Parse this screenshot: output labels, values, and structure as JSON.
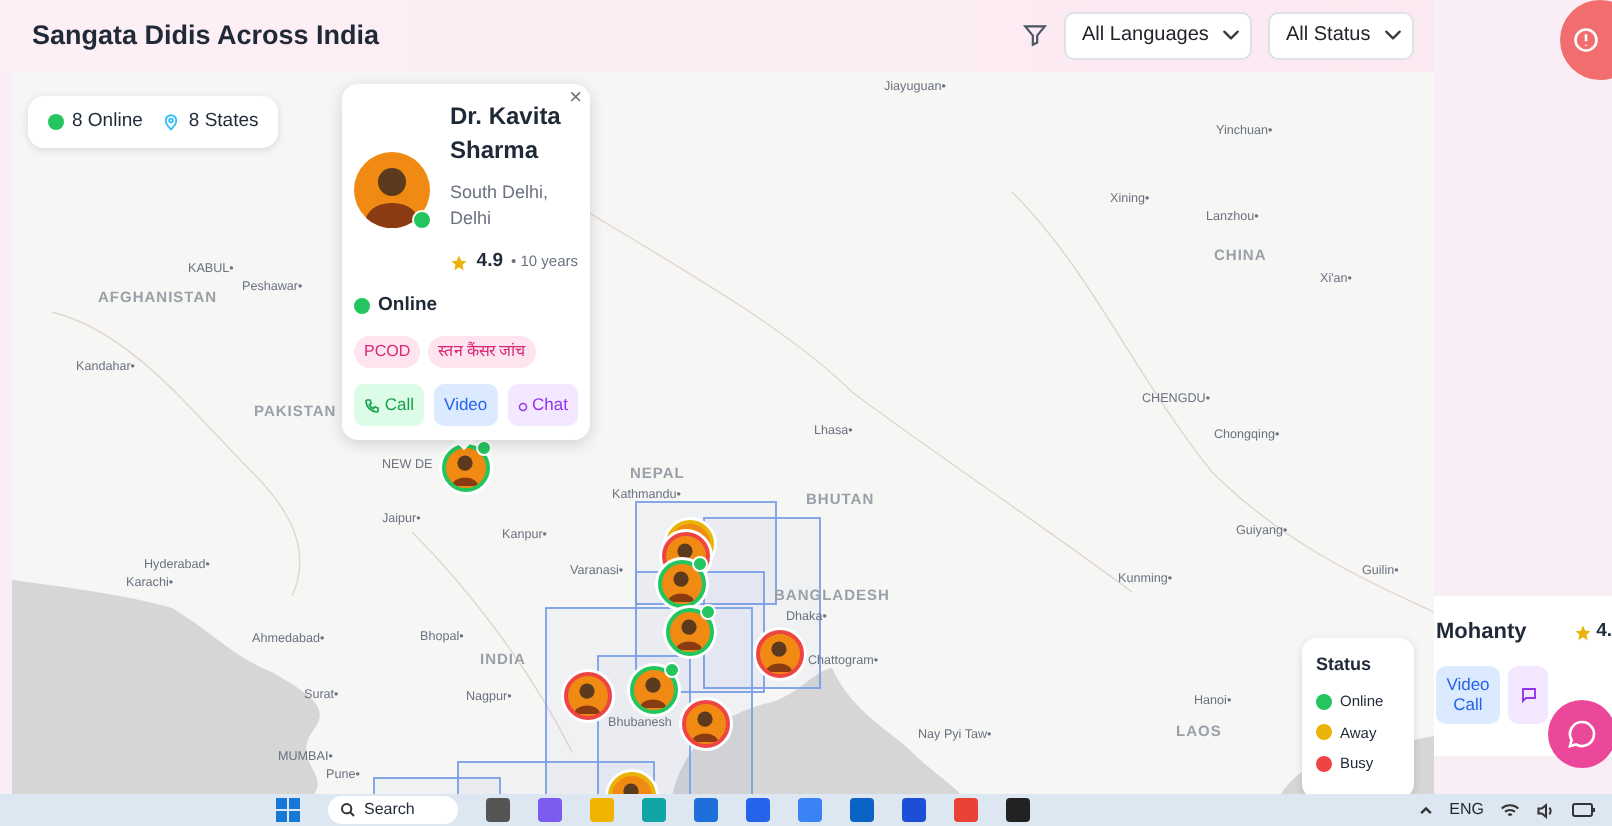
{
  "header": {
    "title": "Sangata Didis Across India",
    "filters": [
      {
        "value": "All Languages"
      },
      {
        "value": "All Status"
      }
    ]
  },
  "stats": [
    {
      "kind": "online",
      "label": "8 Online",
      "color": "#22c55e"
    },
    {
      "kind": "states",
      "label": "8 States"
    }
  ],
  "map": {
    "labels": [
      {
        "kind": "city",
        "text": "Jiayuguan•"
      },
      {
        "kind": "city",
        "text": "Yinchuan•"
      },
      {
        "kind": "city",
        "text": "Xining•"
      },
      {
        "kind": "city",
        "text": "Lanzhou•"
      },
      {
        "kind": "country",
        "text": "CHINA"
      },
      {
        "kind": "city",
        "text": "Xi'an•"
      },
      {
        "kind": "city",
        "text": "KABUL•"
      },
      {
        "kind": "city",
        "text": "Peshawar•"
      },
      {
        "kind": "country",
        "text": "AFGHANISTAN"
      },
      {
        "kind": "city",
        "text": "Kandahar•"
      },
      {
        "kind": "country",
        "text": "PAKISTAN"
      },
      {
        "kind": "city",
        "text": "CHENGDU•"
      },
      {
        "kind": "city",
        "text": "Lhasa•"
      },
      {
        "kind": "city",
        "text": "Chongqing•"
      },
      {
        "kind": "country",
        "text": "NEPAL"
      },
      {
        "kind": "city",
        "text": "Kathmandu•"
      },
      {
        "kind": "country",
        "text": "BHUTAN"
      },
      {
        "kind": "city",
        "text": "Jaipur•"
      },
      {
        "kind": "city",
        "text": "Kanpur•"
      },
      {
        "kind": "city",
        "text": "Guiyang•"
      },
      {
        "kind": "city",
        "text": "Hyderabad•"
      },
      {
        "kind": "city",
        "text": "Karachi•"
      },
      {
        "kind": "city",
        "text": "Varanasi•"
      },
      {
        "kind": "country",
        "text": "BANGLADESH"
      },
      {
        "kind": "city",
        "text": "Kunming•"
      },
      {
        "kind": "city",
        "text": "Guilin•"
      },
      {
        "kind": "city",
        "text": "Ahmedabad•"
      },
      {
        "kind": "city",
        "text": "Bhopal•"
      },
      {
        "kind": "city",
        "text": "Dhaka•"
      },
      {
        "kind": "country",
        "text": "INDIA"
      },
      {
        "kind": "city",
        "text": "Chattogram•"
      },
      {
        "kind": "city",
        "text": "Surat•"
      },
      {
        "kind": "city",
        "text": "Nagpur•"
      },
      {
        "kind": "city",
        "text": "Hanoi•"
      },
      {
        "kind": "city",
        "text": "Nay Pyi Taw•"
      },
      {
        "kind": "country",
        "text": "LAOS"
      },
      {
        "kind": "city",
        "text": "MUMBAI•"
      },
      {
        "kind": "city",
        "text": "Pune•"
      },
      {
        "kind": "city",
        "text": "NEW DE"
      },
      {
        "kind": "city",
        "text": "Bhubanesh"
      }
    ],
    "markers": [
      {
        "color": "#22c55e",
        "online": true
      },
      {
        "color": "#eab308",
        "online": false
      },
      {
        "color": "#ef4444",
        "online": false
      },
      {
        "color": "#22c55e",
        "online": true
      },
      {
        "color": "#22c55e",
        "online": true
      },
      {
        "color": "#ef4444",
        "online": false
      },
      {
        "color": "#ef4444",
        "online": false
      },
      {
        "color": "#22c55e",
        "online": true
      },
      {
        "color": "#ef4444",
        "online": false
      },
      {
        "color": "#eab308",
        "online": false
      }
    ]
  },
  "popup": {
    "close": "×",
    "name": "Dr. Kavita Sharma",
    "location": "South Delhi, Delhi",
    "rating": "4.9",
    "experience": "• 10 years",
    "status": "Online",
    "tags": [
      "PCOD",
      "स्तन कैंसर जांच"
    ],
    "actions": [
      {
        "kind": "call",
        "label": "Call"
      },
      {
        "kind": "video",
        "label": "Video"
      },
      {
        "kind": "chat",
        "label": "Chat"
      }
    ]
  },
  "legend": {
    "title": "Status",
    "items": [
      {
        "label": "Online",
        "color": "#22c55e"
      },
      {
        "label": "Away",
        "color": "#eab308"
      },
      {
        "label": "Busy",
        "color": "#ef4444"
      }
    ]
  },
  "side_card": {
    "name": "Mohanty",
    "rating": "4.",
    "actions": [
      {
        "kind": "video",
        "label": "Video Call"
      },
      {
        "kind": "chat"
      }
    ]
  },
  "taskbar": {
    "search": "Search",
    "language": "ENG"
  }
}
